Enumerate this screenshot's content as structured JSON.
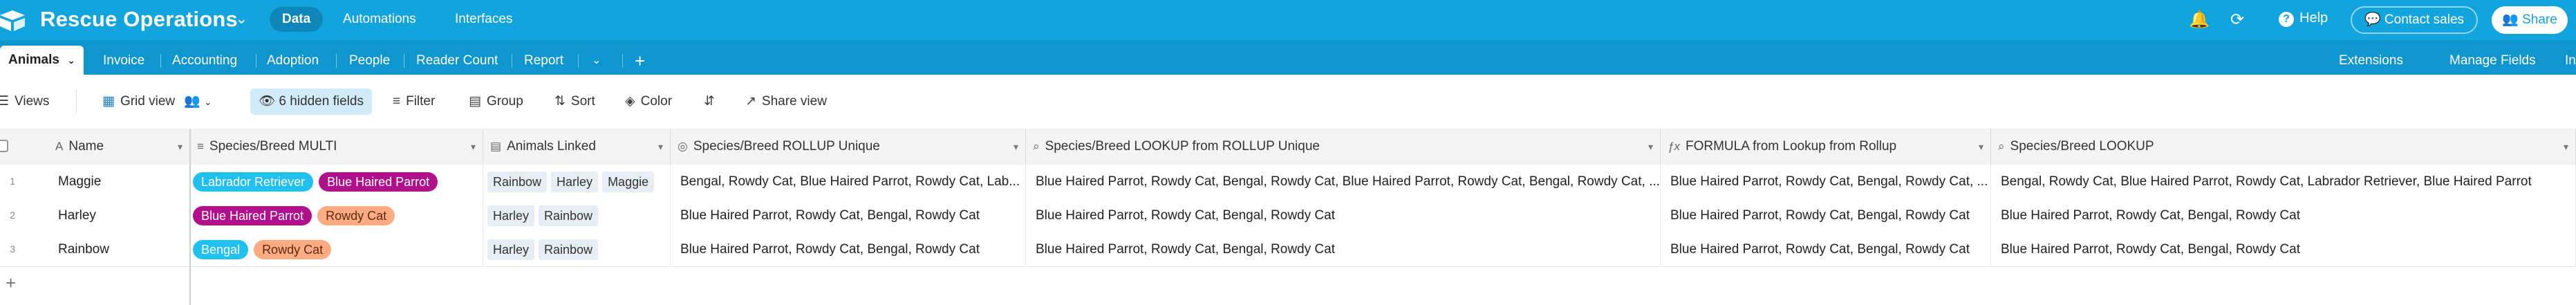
{
  "header": {
    "base_title": "Rescue Operations",
    "nav": [
      "Data",
      "Automations",
      "Interfaces"
    ],
    "help_label": "Help",
    "contact_label": "Contact sales",
    "share_label": "Share",
    "accent_color": "#12a4dd"
  },
  "tables": {
    "active": "Animals",
    "items": [
      "Invoice",
      "Accounting",
      "Adoption",
      "People",
      "Reader Count",
      "Report"
    ],
    "add_symbol": "+",
    "right": [
      "Extensions",
      "Manage Fields",
      "In"
    ]
  },
  "toolbar": {
    "views_label": "Views",
    "grid_view_label": "Grid view",
    "hidden_fields_label": "6 hidden fields",
    "filter_label": "Filter",
    "group_label": "Group",
    "sort_label": "Sort",
    "color_label": "Color",
    "share_view_label": "Share view"
  },
  "grid": {
    "columns": [
      {
        "label": "Name",
        "type_icon": "text-icon"
      },
      {
        "label": "Species/Breed MULTI",
        "type_icon": "multiselect-icon"
      },
      {
        "label": "Animals Linked",
        "type_icon": "link-icon"
      },
      {
        "label": "Species/Breed ROLLUP Unique",
        "type_icon": "rollup-icon"
      },
      {
        "label": "Species/Breed LOOKUP from ROLLUP Unique",
        "type_icon": "lookup-icon"
      },
      {
        "label": "FORMULA from Lookup from Rollup",
        "type_icon": "formula-icon"
      },
      {
        "label": "Species/Breed LOOKUP",
        "type_icon": "lookup-icon"
      }
    ],
    "rows": [
      {
        "num": "1",
        "name": "Maggie",
        "multi": [
          {
            "label": "Labrador Retriever",
            "bg": "#20c0f0",
            "fg": "#ffffff"
          },
          {
            "label": "Blue Haired Parrot",
            "bg": "#b0118a",
            "fg": "#ffffff"
          }
        ],
        "linked": [
          "Rainbow",
          "Harley",
          "Maggie"
        ],
        "rollup": "Bengal, Rowdy Cat, Blue Haired Parrot, Rowdy Cat, Lab...",
        "lookup_rollup": "Blue Haired Parrot, Rowdy Cat, Bengal, Rowdy Cat, Blue Haired Parrot, Rowdy Cat, Bengal, Rowdy Cat, ...",
        "formula": "Blue Haired Parrot, Rowdy Cat, Bengal, Rowdy Cat, ...",
        "lookup": "Bengal, Rowdy Cat, Blue Haired Parrot, Rowdy Cat, Labrador Retriever, Blue Haired Parrot"
      },
      {
        "num": "2",
        "name": "Harley",
        "multi": [
          {
            "label": "Blue Haired Parrot",
            "bg": "#b0118a",
            "fg": "#ffffff"
          },
          {
            "label": "Rowdy Cat",
            "bg": "#ffab82",
            "fg": "#5a2b12"
          }
        ],
        "linked": [
          "Harley",
          "Rainbow"
        ],
        "rollup": "Blue Haired Parrot, Rowdy Cat, Bengal, Rowdy Cat",
        "lookup_rollup": "Blue Haired Parrot, Rowdy Cat, Bengal, Rowdy Cat",
        "formula": "Blue Haired Parrot, Rowdy Cat, Bengal, Rowdy Cat",
        "lookup": "Blue Haired Parrot, Rowdy Cat, Bengal, Rowdy Cat"
      },
      {
        "num": "3",
        "name": "Rainbow",
        "multi": [
          {
            "label": "Bengal",
            "bg": "#20c0f0",
            "fg": "#ffffff"
          },
          {
            "label": "Rowdy Cat",
            "bg": "#ffab82",
            "fg": "#5a2b12"
          }
        ],
        "linked": [
          "Harley",
          "Rainbow"
        ],
        "rollup": "Blue Haired Parrot, Rowdy Cat, Bengal, Rowdy Cat",
        "lookup_rollup": "Blue Haired Parrot, Rowdy Cat, Bengal, Rowdy Cat",
        "formula": "Blue Haired Parrot, Rowdy Cat, Bengal, Rowdy Cat",
        "lookup": "Blue Haired Parrot, Rowdy Cat, Bengal, Rowdy Cat"
      }
    ],
    "add_row_symbol": "+"
  }
}
